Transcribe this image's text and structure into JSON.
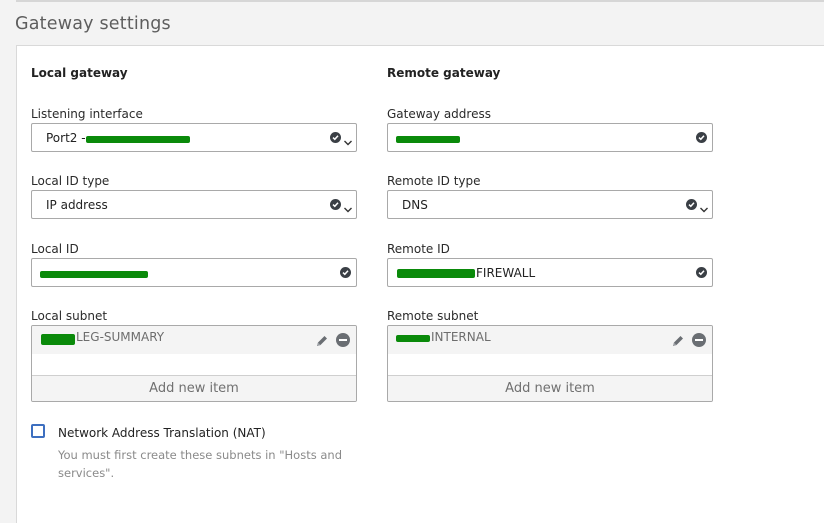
{
  "section": {
    "title": "Gateway settings"
  },
  "local": {
    "heading": "Local gateway",
    "listening_interface": {
      "label": "Listening interface",
      "value": "Port2 -"
    },
    "local_id_type": {
      "label": "Local ID type",
      "value": "IP address"
    },
    "local_id": {
      "label": "Local ID",
      "value": ""
    },
    "local_subnet": {
      "label": "Local subnet",
      "item": "LEG-SUMMARY",
      "add_label": "Add new item"
    }
  },
  "remote": {
    "heading": "Remote gateway",
    "gateway_address": {
      "label": "Gateway address",
      "value": ""
    },
    "remote_id_type": {
      "label": "Remote ID type",
      "value": "DNS"
    },
    "remote_id": {
      "label": "Remote ID",
      "value": "FIREWALL"
    },
    "remote_subnet": {
      "label": "Remote subnet",
      "item": "INTERNAL",
      "add_label": "Add new item"
    }
  },
  "nat": {
    "label": "Network Address Translation (NAT)",
    "checked": false,
    "help": "You must first create these subnets in \"Hosts and services\"."
  },
  "colors": {
    "accent": "#3d6fc0",
    "redaction": "#0a8a0a"
  },
  "icons": [
    "check-circle-icon",
    "chevron-down-icon",
    "pencil-icon",
    "remove-circle-icon"
  ]
}
